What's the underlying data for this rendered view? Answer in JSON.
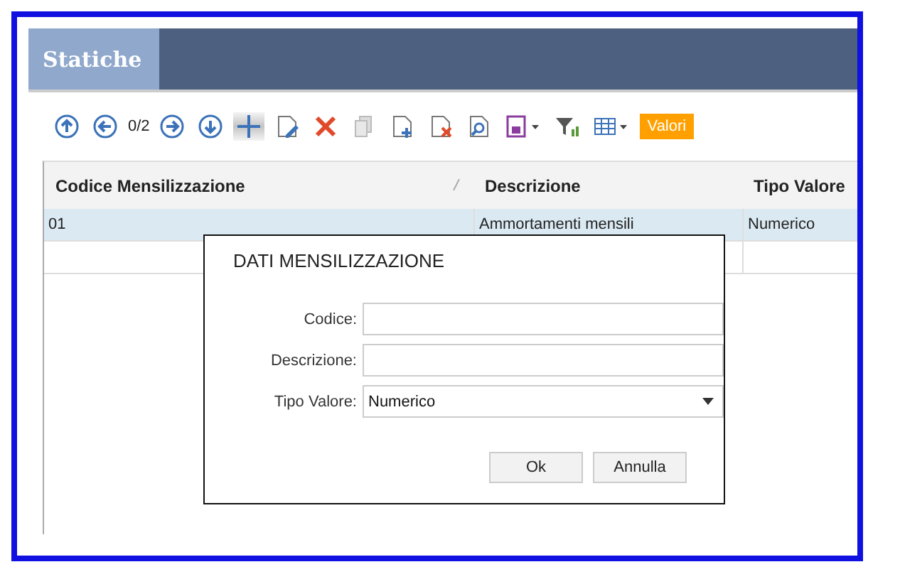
{
  "tab": {
    "label": "Statiche",
    "selected": true
  },
  "toolbar": {
    "tools": [
      {
        "kind": "first",
        "pressed": false
      },
      {
        "kind": "prev",
        "pressed": false
      },
      {
        "kind": "counter",
        "text": "0/2"
      },
      {
        "kind": "next",
        "pressed": false
      },
      {
        "kind": "last",
        "pressed": false
      },
      {
        "kind": "add",
        "pressed": true
      },
      {
        "kind": "edit",
        "pressed": false
      },
      {
        "kind": "delete",
        "pressed": false
      },
      {
        "kind": "copy",
        "pressed": false
      },
      {
        "kind": "newdoc",
        "pressed": false
      },
      {
        "kind": "removedoc",
        "pressed": false
      },
      {
        "kind": "preview",
        "pressed": false
      },
      {
        "kind": "save",
        "pressed": false
      },
      {
        "kind": "filter",
        "pressed": false
      },
      {
        "kind": "grid",
        "pressed": false
      },
      {
        "kind": "action",
        "text": "Valori"
      }
    ]
  },
  "table": {
    "columns": [
      {
        "label": "Codice Mensilizzazione",
        "sorted": true
      },
      {
        "label": "Descrizione"
      },
      {
        "label": "Tipo Valore"
      }
    ],
    "rows": [
      {
        "cells": [
          "01",
          "Ammortamenti mensili",
          "Numerico"
        ],
        "selected": true
      }
    ]
  },
  "dialog": {
    "title": "DATI MENSILIZZAZIONE",
    "fields": [
      {
        "label": "Codice:",
        "kind": "text"
      },
      {
        "label": "Descrizione:",
        "kind": "text"
      },
      {
        "label": "Tipo Valore:",
        "kind": "select",
        "value": "Numerico"
      }
    ],
    "buttons": [
      "Ok",
      "Annulla"
    ]
  }
}
